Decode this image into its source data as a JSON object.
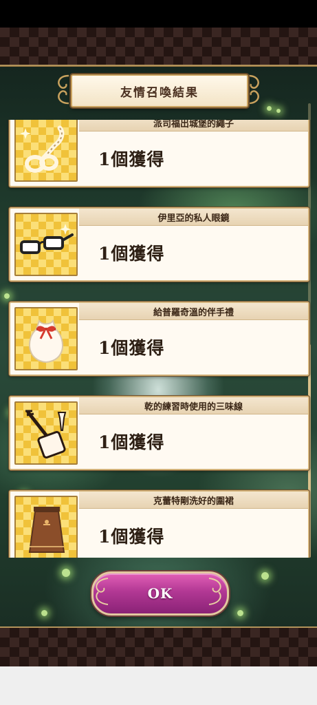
{
  "title": "友情召喚結果",
  "items": [
    {
      "name": "派司福出城堡的繩子",
      "qty": "1個獲得",
      "icon": "rope-icon"
    },
    {
      "name": "伊里亞的私人眼鏡",
      "qty": "1個獲得",
      "icon": "glasses-icon"
    },
    {
      "name": "給普羅奇溫的伴手禮",
      "qty": "1個獲得",
      "icon": "gift-bag-icon"
    },
    {
      "name": "乾的練習時使用的三味線",
      "qty": "1個獲得",
      "icon": "shamisen-icon"
    },
    {
      "name": "克蕾特剛洗好的圍裙",
      "qty": "1個獲得",
      "icon": "apron-icon"
    }
  ],
  "ok_label": "OK",
  "colors": {
    "accent_pink": "#b23894",
    "gold_border": "#d2b27a",
    "icon_gold": "#f0c23a"
  }
}
